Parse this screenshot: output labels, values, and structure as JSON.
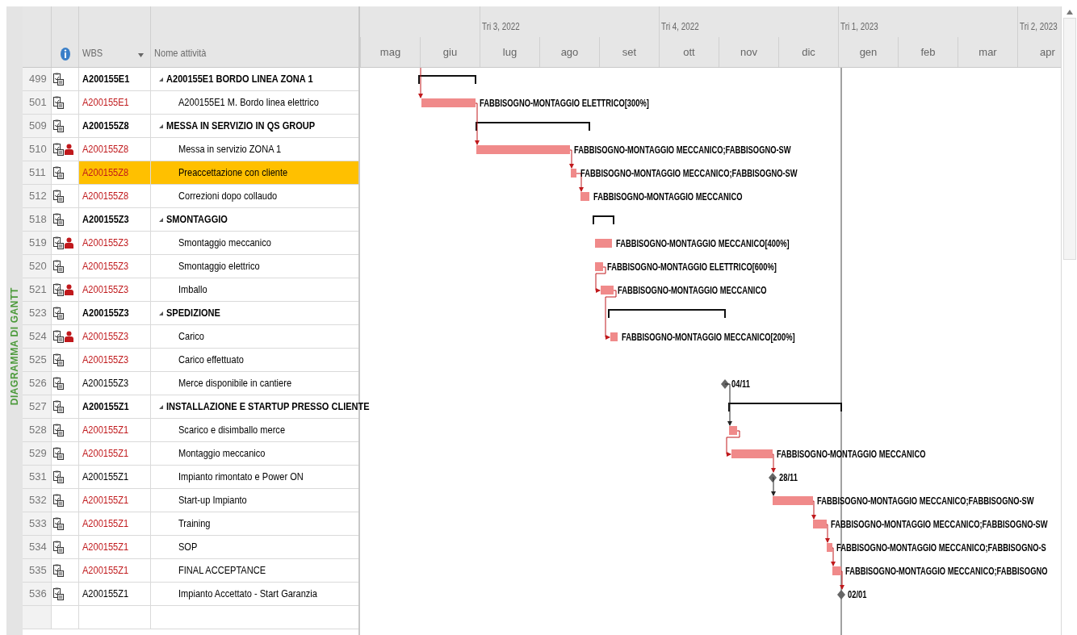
{
  "side_label": "DIAGRAMMA DI GANTT",
  "columns": [
    {
      "label": "WBS"
    },
    {
      "label": "Nome attività"
    }
  ],
  "timescale": {
    "quarters": [
      {
        "label": "Tri 3, 2022"
      },
      {
        "label": "Tri 4, 2022"
      },
      {
        "label": "Tri 1, 2023"
      },
      {
        "label": "Tri 2, 2023"
      }
    ],
    "months": [
      "mag",
      "giu",
      "lug",
      "ago",
      "set",
      "ott",
      "nov",
      "dic",
      "gen",
      "feb",
      "mar",
      "apr"
    ]
  },
  "tasks": [
    {
      "id": "499",
      "wbs": "A200155E1",
      "name": "A200155E1 BORDO LINEA ZONA 1",
      "kind": "summary",
      "expanded": true,
      "critical": false,
      "assigned": false,
      "selected": false,
      "children": [
        {
          "id": "501",
          "wbs": "A200155E1",
          "name": "A200155E1 M. Bordo linea elettrico",
          "kind": "task",
          "critical": true,
          "assigned": false,
          "selected": false,
          "bar_label": "FABBISOGNO-MONTAGGIO ELETTRICO[300%]"
        }
      ]
    },
    {
      "id": "509",
      "wbs": "A200155Z8",
      "name": "MESSA IN SERVIZIO IN QS GROUP",
      "kind": "summary",
      "expanded": true,
      "critical": false,
      "assigned": false,
      "selected": false,
      "children": [
        {
          "id": "510",
          "wbs": "A200155Z8",
          "name": "Messa in servizio ZONA 1",
          "kind": "task",
          "critical": true,
          "assigned": true,
          "selected": false,
          "bar_label": "FABBISOGNO-MONTAGGIO MECCANICO;FABBISOGNO-SW"
        },
        {
          "id": "511",
          "wbs": "A200155Z8",
          "name": "Preaccettazione con cliente",
          "kind": "task",
          "critical": true,
          "assigned": false,
          "selected": true,
          "bar_label": "FABBISOGNO-MONTAGGIO MECCANICO;FABBISOGNO-SW"
        },
        {
          "id": "512",
          "wbs": "A200155Z8",
          "name": "Correzioni dopo collaudo",
          "kind": "task",
          "critical": true,
          "assigned": false,
          "selected": false,
          "bar_label": "FABBISOGNO-MONTAGGIO MECCANICO"
        }
      ]
    },
    {
      "id": "518",
      "wbs": "A200155Z3",
      "name": "SMONTAGGIO",
      "kind": "summary",
      "expanded": true,
      "critical": false,
      "assigned": false,
      "selected": false,
      "children": [
        {
          "id": "519",
          "wbs": "A200155Z3",
          "name": "Smontaggio meccanico",
          "kind": "task",
          "critical": true,
          "assigned": true,
          "selected": false,
          "bar_label": "FABBISOGNO-MONTAGGIO MECCANICO[400%]"
        },
        {
          "id": "520",
          "wbs": "A200155Z3",
          "name": "Smontaggio elettrico",
          "kind": "task",
          "critical": true,
          "assigned": false,
          "selected": false,
          "bar_label": "FABBISOGNO-MONTAGGIO ELETTRICO[600%]"
        },
        {
          "id": "521",
          "wbs": "A200155Z3",
          "name": "Imballo",
          "kind": "task",
          "critical": true,
          "assigned": true,
          "selected": false,
          "bar_label": "FABBISOGNO-MONTAGGIO MECCANICO"
        }
      ]
    },
    {
      "id": "523",
      "wbs": "A200155Z3",
      "name": "SPEDIZIONE",
      "kind": "summary",
      "expanded": true,
      "critical": false,
      "assigned": false,
      "selected": false,
      "children": [
        {
          "id": "524",
          "wbs": "A200155Z3",
          "name": "Carico",
          "kind": "task",
          "critical": true,
          "assigned": true,
          "selected": false,
          "bar_label": "FABBISOGNO-MONTAGGIO MECCANICO[200%]"
        },
        {
          "id": "525",
          "wbs": "A200155Z3",
          "name": "Carico effettuato",
          "kind": "empty",
          "critical": true,
          "assigned": false,
          "selected": false
        },
        {
          "id": "526",
          "wbs": "A200155Z3",
          "name": "Merce disponibile in cantiere",
          "kind": "milestone",
          "critical": false,
          "assigned": false,
          "selected": false,
          "bar_label": "04/11"
        }
      ]
    },
    {
      "id": "527",
      "wbs": "A200155Z1",
      "name": "INSTALLAZIONE E STARTUP PRESSO CLIENTE",
      "kind": "summary",
      "expanded": true,
      "critical": false,
      "assigned": false,
      "selected": false,
      "children": [
        {
          "id": "528",
          "wbs": "A200155Z1",
          "name": "Scarico e disimballo merce",
          "kind": "task",
          "critical": true,
          "assigned": false,
          "selected": false
        },
        {
          "id": "529",
          "wbs": "A200155Z1",
          "name": "Montaggio meccanico",
          "kind": "task",
          "critical": true,
          "assigned": false,
          "selected": false,
          "bar_label": "FABBISOGNO-MONTAGGIO MECCANICO"
        },
        {
          "id": "531",
          "wbs": "A200155Z1",
          "name": "Impianto rimontato e Power ON",
          "kind": "milestone",
          "critical": false,
          "assigned": false,
          "selected": false,
          "bar_label": "28/11"
        },
        {
          "id": "532",
          "wbs": "A200155Z1",
          "name": "Start-up Impianto",
          "kind": "task",
          "critical": true,
          "assigned": false,
          "selected": false,
          "bar_label": "FABBISOGNO-MONTAGGIO MECCANICO;FABBISOGNO-SW"
        },
        {
          "id": "533",
          "wbs": "A200155Z1",
          "name": "Training",
          "kind": "task",
          "critical": true,
          "assigned": false,
          "selected": false,
          "bar_label": "FABBISOGNO-MONTAGGIO MECCANICO;FABBISOGNO-SW"
        },
        {
          "id": "534",
          "wbs": "A200155Z1",
          "name": "SOP",
          "kind": "task",
          "critical": true,
          "assigned": false,
          "selected": false,
          "bar_label": "FABBISOGNO-MONTAGGIO MECCANICO;FABBISOGNO-S"
        },
        {
          "id": "535",
          "wbs": "A200155Z1",
          "name": "FINAL ACCEPTANCE",
          "kind": "task",
          "critical": true,
          "assigned": false,
          "selected": false,
          "bar_label": "FABBISOGNO-MONTAGGIO MECCANICO;FABBISOGNO"
        },
        {
          "id": "536",
          "wbs": "A200155Z1",
          "name": "Impianto Accettato - Start Garanzia",
          "kind": "milestone",
          "critical": false,
          "assigned": false,
          "selected": false,
          "bar_label": "02/01"
        }
      ]
    }
  ]
}
